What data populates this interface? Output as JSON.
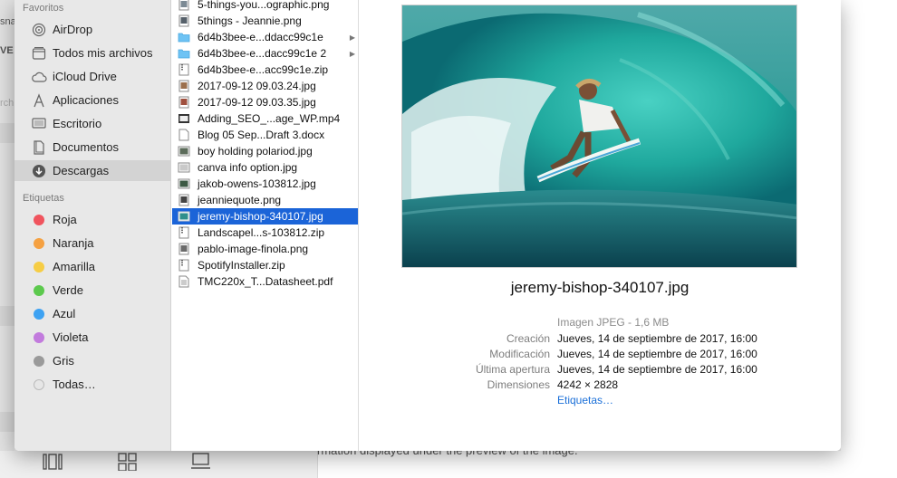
{
  "background": {
    "left_fragments": [
      "sna",
      "VE",
      "rch"
    ],
    "bottom_text": "rmation displayed under the preview of the image."
  },
  "sidebar": {
    "favorites_title": "Favoritos",
    "favorites": [
      {
        "label": "AirDrop",
        "icon": "airdrop-icon"
      },
      {
        "label": "Todos mis archivos",
        "icon": "all-files-icon"
      },
      {
        "label": "iCloud Drive",
        "icon": "cloud-icon"
      },
      {
        "label": "Aplicaciones",
        "icon": "applications-icon"
      },
      {
        "label": "Escritorio",
        "icon": "desktop-icon"
      },
      {
        "label": "Documentos",
        "icon": "documents-icon"
      },
      {
        "label": "Descargas",
        "icon": "downloads-icon",
        "selected": true
      }
    ],
    "tags_title": "Etiquetas",
    "tags": [
      {
        "label": "Roja",
        "color": "#f0545e"
      },
      {
        "label": "Naranja",
        "color": "#f5a142"
      },
      {
        "label": "Amarilla",
        "color": "#f6cd45"
      },
      {
        "label": "Verde",
        "color": "#5cc94d"
      },
      {
        "label": "Azul",
        "color": "#3ea2f2"
      },
      {
        "label": "Violeta",
        "color": "#c27bdd"
      },
      {
        "label": "Gris",
        "color": "#9a9a9a"
      },
      {
        "label": "Todas…",
        "color": "#e6e6e6"
      }
    ]
  },
  "files": [
    {
      "name": "5-things-you...ographic.png",
      "type": "image"
    },
    {
      "name": "5things - Jeannie.png",
      "type": "image"
    },
    {
      "name": "6d4b3bee-e...ddacc99c1e",
      "type": "folder",
      "arrow": "▶"
    },
    {
      "name": "6d4b3bee-e...dacc99c1e 2",
      "type": "folder",
      "arrow": "▶"
    },
    {
      "name": "6d4b3bee-e...acc99c1e.zip",
      "type": "zip"
    },
    {
      "name": "2017-09-12 09.03.24.jpg",
      "type": "image"
    },
    {
      "name": "2017-09-12 09.03.35.jpg",
      "type": "image"
    },
    {
      "name": "Adding_SEO_...age_WP.mp4",
      "type": "video"
    },
    {
      "name": "Blog 05 Sep...Draft 3.docx",
      "type": "doc"
    },
    {
      "name": "boy holding polariod.jpg",
      "type": "image"
    },
    {
      "name": "canva info option.jpg",
      "type": "image"
    },
    {
      "name": "jakob-owens-103812.jpg",
      "type": "image"
    },
    {
      "name": "jeanniequote.png",
      "type": "image"
    },
    {
      "name": "jeremy-bishop-340107.jpg",
      "type": "image",
      "selected": true
    },
    {
      "name": "Landscapel...s-103812.zip",
      "type": "zip"
    },
    {
      "name": "pablo-image-finola.png",
      "type": "image"
    },
    {
      "name": "SpotifyInstaller.zip",
      "type": "zip"
    },
    {
      "name": "TMC220x_T...Datasheet.pdf",
      "type": "pdf"
    }
  ],
  "preview": {
    "filename": "jeremy-bishop-340107.jpg",
    "kind": "Imagen JPEG - 1,6 MB",
    "rows": [
      {
        "label": "Creación",
        "value": "Jueves, 14 de septiembre de 2017, 16:00"
      },
      {
        "label": "Modificación",
        "value": "Jueves, 14 de septiembre de 2017, 16:00"
      },
      {
        "label": "Última apertura",
        "value": "Jueves, 14 de septiembre de 2017, 16:00"
      },
      {
        "label": "Dimensiones",
        "value": "4242 × 2828"
      }
    ],
    "tags_link": "Etiquetas…"
  },
  "colors": {
    "selection": "#1b64d8",
    "link": "#1a6fd8"
  }
}
